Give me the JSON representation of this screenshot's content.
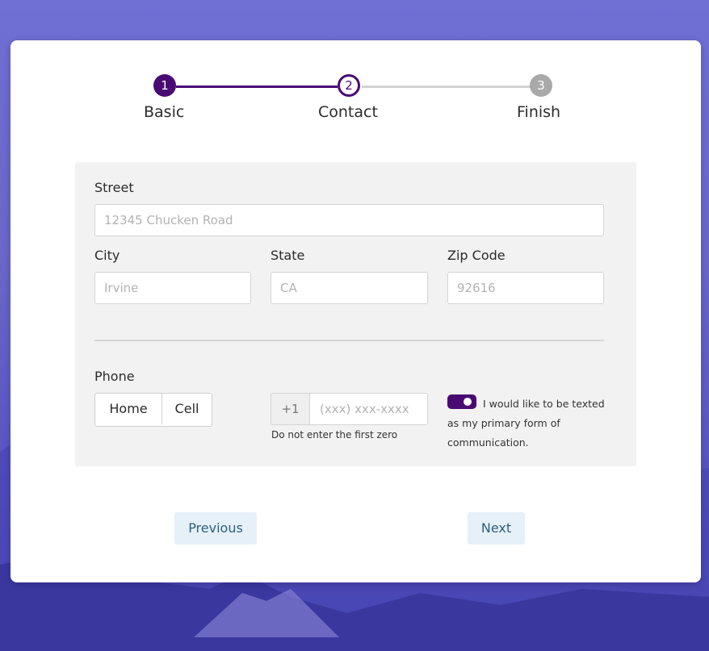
{
  "stepper": {
    "steps": [
      {
        "number": "1",
        "label": "Basic",
        "state": "done"
      },
      {
        "number": "2",
        "label": "Contact",
        "state": "current"
      },
      {
        "number": "3",
        "label": "Finish",
        "state": "todo"
      }
    ]
  },
  "address": {
    "street_label": "Street",
    "street_placeholder": "12345 Chucken Road",
    "city_label": "City",
    "city_placeholder": "Irvine",
    "state_label": "State",
    "state_placeholder": "CA",
    "zip_label": "Zip Code",
    "zip_placeholder": "92616"
  },
  "phone": {
    "label": "Phone",
    "type_options": [
      "Home",
      "Cell"
    ],
    "country_code": "+1",
    "placeholder": "(xxx) xxx-xxxx",
    "helper_text": "Do not enter the first zero",
    "sms_toggle_on": true,
    "sms_label": "I would like to be texted as my primary form of communication."
  },
  "navigation": {
    "previous_label": "Previous",
    "next_label": "Next"
  },
  "colors": {
    "accent": "#4a0a73",
    "button_bg": "#e6f0f8",
    "button_text": "#2e5f7e",
    "inactive_step": "#a9a9a9"
  }
}
